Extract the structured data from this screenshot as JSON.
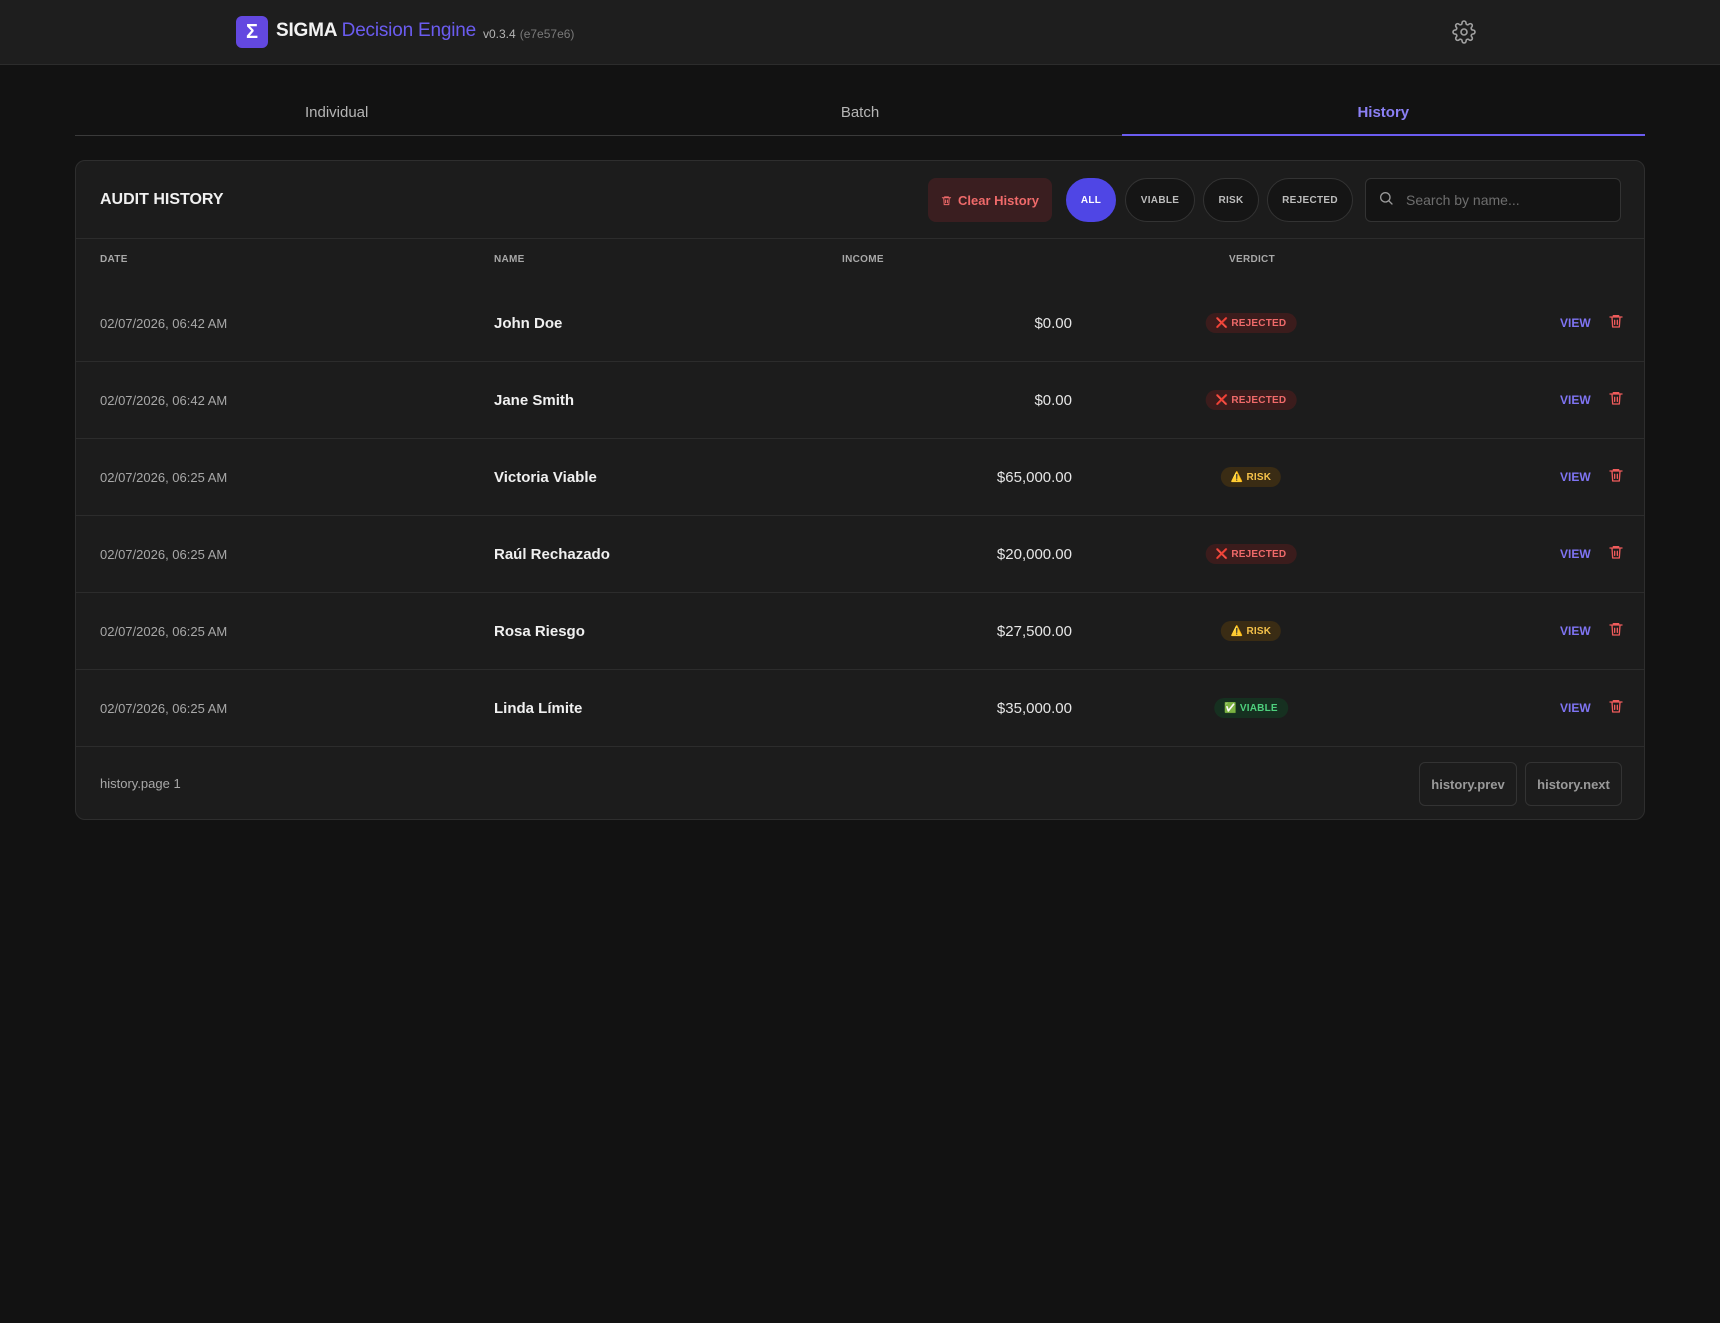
{
  "header": {
    "logo_glyph": "Σ",
    "brand_main": "SIGMA",
    "brand_accent": "Decision Engine",
    "version": "v0.3.4",
    "hash": "(e7e57e6)"
  },
  "tabs": [
    {
      "label": "Individual",
      "active": false
    },
    {
      "label": "Batch",
      "active": false
    },
    {
      "label": "History",
      "active": true
    }
  ],
  "history": {
    "title": "AUDIT HISTORY",
    "clear_label": "Clear History",
    "filters": [
      "ALL",
      "VIABLE",
      "RISK",
      "REJECTED"
    ],
    "active_filter": "ALL",
    "search_placeholder": "Search by name...",
    "columns": {
      "date": "DATE",
      "name": "NAME",
      "income": "INCOME",
      "verdict": "VERDICT"
    },
    "rows": [
      {
        "date": "02/07/2026, 06:42 AM",
        "name": "John Doe",
        "income": "$0.00",
        "verdict": "REJECTED",
        "verdict_icon": "❌",
        "action": "VIEW"
      },
      {
        "date": "02/07/2026, 06:42 AM",
        "name": "Jane Smith",
        "income": "$0.00",
        "verdict": "REJECTED",
        "verdict_icon": "❌",
        "action": "VIEW"
      },
      {
        "date": "02/07/2026, 06:25 AM",
        "name": "Victoria Viable",
        "income": "$65,000.00",
        "verdict": "RISK",
        "verdict_icon": "⚠️",
        "action": "VIEW"
      },
      {
        "date": "02/07/2026, 06:25 AM",
        "name": "Raúl Rechazado",
        "income": "$20,000.00",
        "verdict": "REJECTED",
        "verdict_icon": "❌",
        "action": "VIEW"
      },
      {
        "date": "02/07/2026, 06:25 AM",
        "name": "Rosa Riesgo",
        "income": "$27,500.00",
        "verdict": "RISK",
        "verdict_icon": "⚠️",
        "action": "VIEW"
      },
      {
        "date": "02/07/2026, 06:25 AM",
        "name": "Linda Límite",
        "income": "$35,000.00",
        "verdict": "VIABLE",
        "verdict_icon": "✅",
        "action": "VIEW"
      }
    ],
    "page_label": "history.page 1",
    "prev_label": "history.prev",
    "next_label": "history.next"
  },
  "colors": {
    "accent": "#6b5cf0",
    "filter_active": "#4f46e5",
    "rejected": "#ef6a6a",
    "risk": "#f5c24a",
    "viable": "#4ed07d"
  }
}
